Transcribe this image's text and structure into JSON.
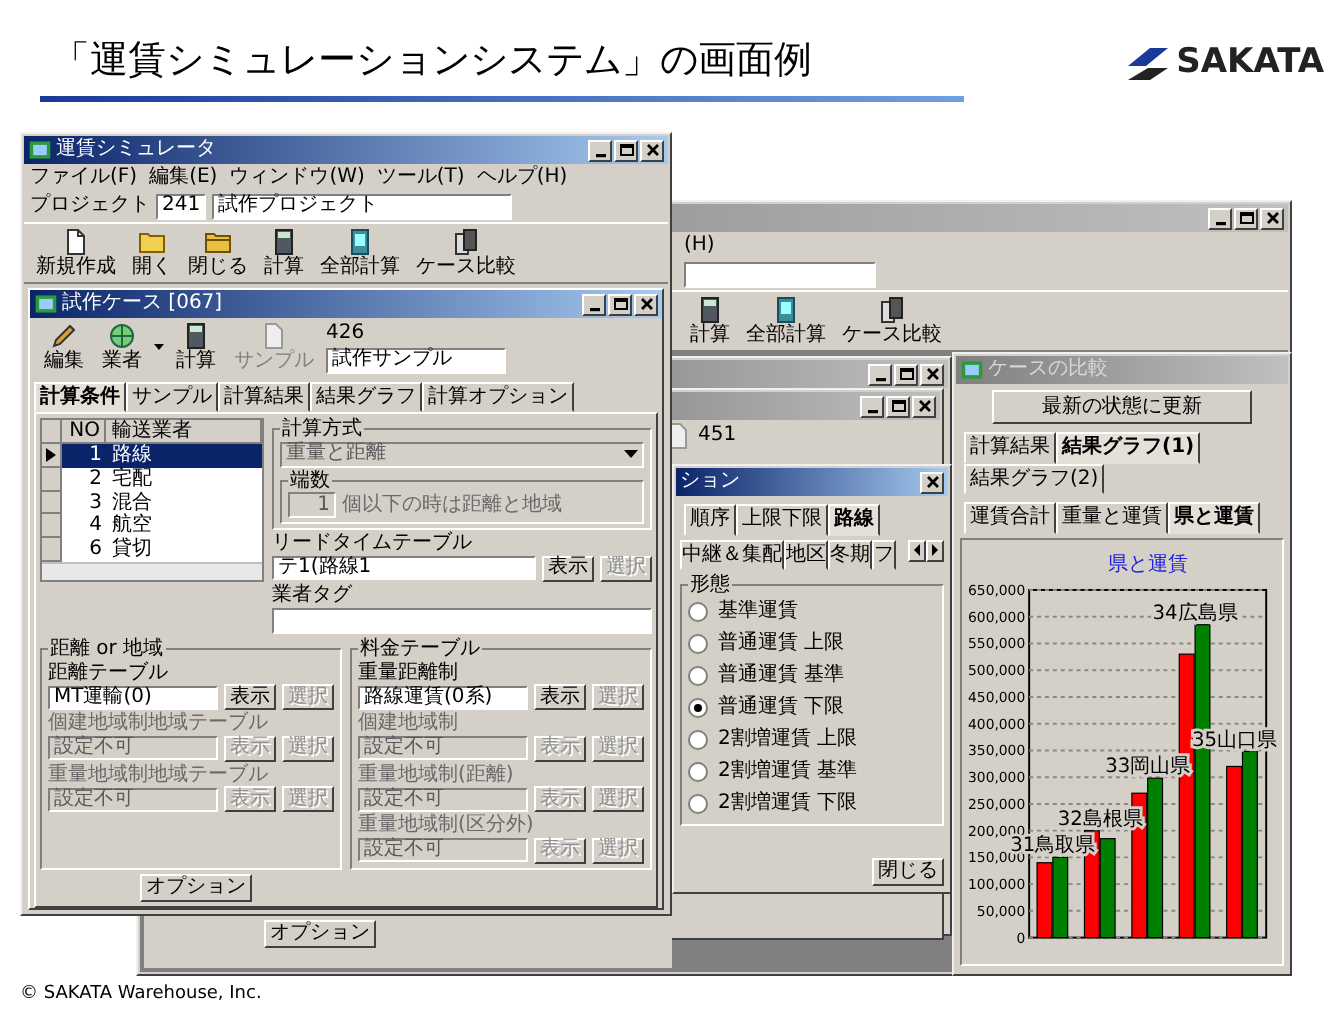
{
  "slide": {
    "title": "「運賃シミュレーションシステム」の画面例",
    "logo": "SAKATA",
    "copyright": "© SAKATA Warehouse, Inc."
  },
  "simulator_window": {
    "title": "運賃シミュレータ",
    "menu": [
      "ファイル(F)",
      "編集(E)",
      "ウィンドウ(W)",
      "ツール(T)",
      "ヘルプ(H)"
    ],
    "project": {
      "label": "プロジェクト",
      "number": "241",
      "name": "試作プロジェクト"
    },
    "toolbar": [
      {
        "label": "新規作成"
      },
      {
        "label": "開く"
      },
      {
        "label": "閉じる"
      },
      {
        "label": "計算"
      },
      {
        "label": "全部計算"
      },
      {
        "label": "ケース比較"
      }
    ],
    "case_window": {
      "title": "試作ケース [067]",
      "toolbar": [
        {
          "label": "編集",
          "disabled": false,
          "dropdown": false
        },
        {
          "label": "業者",
          "disabled": false,
          "dropdown": true
        },
        {
          "label": "計算",
          "disabled": false,
          "dropdown": false
        },
        {
          "label": "サンプル",
          "disabled": true,
          "dropdown": false
        }
      ],
      "sample_number": "426",
      "sample_name": "試作サンプル",
      "tabs": [
        {
          "label": "計算条件",
          "selected": true
        },
        {
          "label": "サンプル",
          "selected": false
        },
        {
          "label": "計算結果",
          "selected": false
        },
        {
          "label": "結果グラフ",
          "selected": false
        },
        {
          "label": "計算オプション",
          "selected": false
        }
      ],
      "carriers": {
        "columns": [
          "NO",
          "輸送業者"
        ],
        "rows": [
          {
            "no": "1",
            "name": "路線",
            "selected": true
          },
          {
            "no": "2",
            "name": "宅配",
            "selected": false
          },
          {
            "no": "3",
            "name": "混合",
            "selected": false
          },
          {
            "no": "4",
            "name": "航空",
            "selected": false
          },
          {
            "no": "6",
            "name": "貸切",
            "selected": false
          }
        ]
      },
      "calc_method": {
        "title": "計算方式",
        "value": "重量と距離",
        "disabled": true,
        "fraction": {
          "title": "端数",
          "value": "1",
          "note": "個以下の時は距離と地域",
          "disabled": true
        }
      },
      "lead_time": {
        "label": "リードタイムテーブル",
        "value": "テ1(路線1",
        "disabled": false,
        "buttons": [
          {
            "label": "表示",
            "disabled": false
          },
          {
            "label": "選択",
            "disabled": true
          }
        ]
      },
      "carrier_tag": {
        "label": "業者タグ"
      },
      "groups": [
        {
          "title": "距離 or 地域",
          "tables": [
            {
              "label": "距離テーブル",
              "value": "MT運輸(0)",
              "disabled": false,
              "buttons": [
                {
                  "label": "表示",
                  "disabled": false
                },
                {
                  "label": "選択",
                  "disabled": true
                }
              ]
            },
            {
              "label": "個建地域制地域テーブル",
              "value": "設定不可",
              "disabled": true,
              "buttons": [
                {
                  "label": "表示",
                  "disabled": true
                },
                {
                  "label": "選択",
                  "disabled": true
                }
              ]
            },
            {
              "label": "重量地域制地域テーブル",
              "value": "設定不可",
              "disabled": true,
              "buttons": [
                {
                  "label": "表示",
                  "disabled": true
                },
                {
                  "label": "選択",
                  "disabled": true
                }
              ]
            }
          ]
        },
        {
          "title": "料金テーブル",
          "tables": [
            {
              "label": "重量距離制",
              "value": "路線運賃(0系)",
              "disabled": false,
              "buttons": [
                {
                  "label": "表示",
                  "disabled": false
                },
                {
                  "label": "選択",
                  "disabled": true
                }
              ]
            },
            {
              "label": "個建地域制",
              "value": "設定不可",
              "disabled": true,
              "buttons": [
                {
                  "label": "表示",
                  "disabled": true
                },
                {
                  "label": "選択",
                  "disabled": true
                }
              ]
            },
            {
              "label": "重量地域制(距離)",
              "value": "設定不可",
              "disabled": true,
              "buttons": [
                {
                  "label": "表示",
                  "disabled": true
                },
                {
                  "label": "選択",
                  "disabled": true
                }
              ]
            },
            {
              "label": "重量地域制(区分外)",
              "value": "設定不可",
              "disabled": true,
              "buttons": [
                {
                  "label": "表示",
                  "disabled": true
                },
                {
                  "label": "選択",
                  "disabled": true
                }
              ]
            }
          ]
        }
      ],
      "option_button": "オプション"
    }
  },
  "main_window": {
    "menu": [
      "(H)"
    ],
    "toolbar": [
      {
        "label": "計算"
      },
      {
        "label": "全部計算"
      },
      {
        "label": "ケース比較"
      }
    ],
    "option_button": "オプション"
  },
  "case_window_behind": {
    "number": "451"
  },
  "options_dialog": {
    "title": "ション",
    "tabs": [
      {
        "label": "順序",
        "selected": false
      },
      {
        "label": "上限下限",
        "selected": false
      },
      {
        "label": "路線",
        "selected": true
      }
    ],
    "subtabs": [
      {
        "label": "中継＆集配",
        "selected": false
      },
      {
        "label": "地区",
        "selected": false
      },
      {
        "label": "冬期",
        "selected": false
      },
      {
        "label": "フ",
        "selected": false
      }
    ],
    "group_title": "形態",
    "options": [
      {
        "label": "基準運賃",
        "selected": false
      },
      {
        "label": "普通運賃 上限",
        "selected": false
      },
      {
        "label": "普通運賃 基準",
        "selected": false
      },
      {
        "label": "普通運賃 下限",
        "selected": true
      },
      {
        "label": "2割増運賃 上限",
        "selected": false
      },
      {
        "label": "2割増運賃 基準",
        "selected": false
      },
      {
        "label": "2割増運賃 下限",
        "selected": false
      }
    ],
    "close_button": "閉じる"
  },
  "compare_window": {
    "title": "ケースの比較",
    "refresh_button": "最新の状態に更新",
    "tabs": [
      {
        "label": "計算結果",
        "selected": false
      },
      {
        "label": "結果グラフ(1)",
        "selected": true
      },
      {
        "label": "結果グラフ(2)",
        "selected": false
      }
    ],
    "subtabs": [
      {
        "label": "運賃合計",
        "selected": false
      },
      {
        "label": "重量と運賃",
        "selected": false
      },
      {
        "label": "県と運賃",
        "selected": true
      }
    ],
    "chart_data": {
      "type": "bar",
      "title": "県と運賃",
      "categories": [
        "31鳥取県",
        "32島根県",
        "33岡山県",
        "34広島県",
        "35山口県"
      ],
      "series": [
        {
          "color": "#ff0000",
          "values": [
            140000,
            200000,
            270000,
            530000,
            320000
          ]
        },
        {
          "color": "#008000",
          "values": [
            150000,
            185000,
            298000,
            585000,
            348000
          ]
        }
      ],
      "ylim": [
        0,
        650000
      ],
      "grid": true,
      "yticks": [
        {
          "value": 0,
          "label": "0"
        },
        {
          "value": 50000,
          "label": "50,000"
        },
        {
          "value": 100000,
          "label": "100,000"
        },
        {
          "value": 150000,
          "label": "150,000"
        },
        {
          "value": 200000,
          "label": "200,000"
        },
        {
          "value": 250000,
          "label": "250,000"
        },
        {
          "value": 300000,
          "label": "300,000"
        },
        {
          "value": 350000,
          "label": "350,000"
        },
        {
          "value": 400000,
          "label": "400,000"
        },
        {
          "value": 450000,
          "label": "450,000"
        },
        {
          "value": 500000,
          "label": "500,000"
        },
        {
          "value": 550000,
          "label": "550,000"
        },
        {
          "value": 600000,
          "label": "600,000"
        },
        {
          "value": 650000,
          "label": "650,000"
        }
      ]
    }
  }
}
